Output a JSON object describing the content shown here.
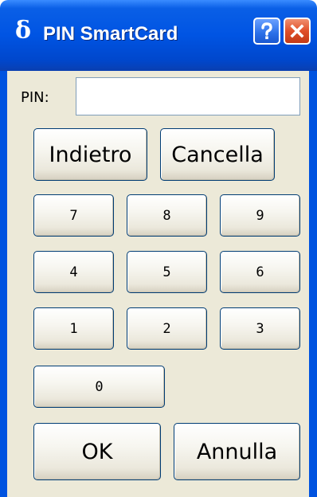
{
  "window": {
    "title": "PIN SmartCard",
    "icon": "delta-icon",
    "icon_glyph": "δ",
    "help_button": "?",
    "close_button": "✕"
  },
  "pin": {
    "label": "PIN:",
    "value": "",
    "placeholder": ""
  },
  "actions": {
    "back_label": "Indietro",
    "clear_label": "Cancella",
    "ok_label": "OK",
    "cancel_label": "Annulla"
  },
  "keypad": {
    "k7": "7",
    "k8": "8",
    "k9": "9",
    "k4": "4",
    "k5": "5",
    "k6": "6",
    "k1": "1",
    "k2": "2",
    "k3": "3",
    "k0": "0"
  },
  "colors": {
    "titlebar": "#0054e3",
    "client_background": "#ece9d8",
    "close_button": "#e0502a",
    "button_border": "#003c74"
  }
}
